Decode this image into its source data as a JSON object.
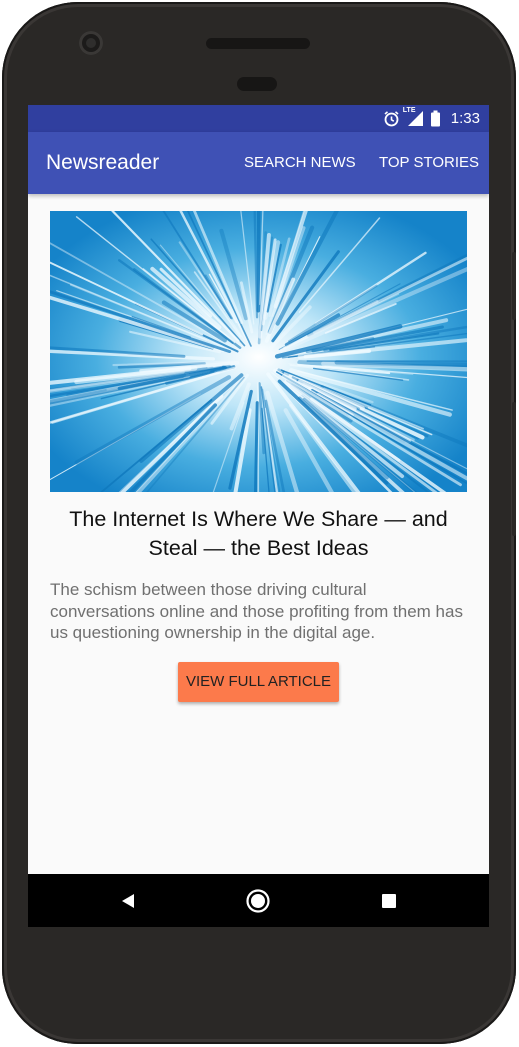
{
  "status_bar": {
    "time": "1:33",
    "network_label": "LTE",
    "icons": [
      "alarm-icon",
      "signal-icon",
      "battery-icon"
    ]
  },
  "app_bar": {
    "title": "Newsreader",
    "actions": [
      {
        "label": "SEARCH NEWS"
      },
      {
        "label": "TOP STORIES"
      }
    ]
  },
  "article": {
    "image_icon": "digital-tunnel-image",
    "headline": "The Internet Is Where We Share — and Steal — the Best Ideas",
    "summary": "The schism between those driving cultural conversations online and those profiting from them has us questioning ownership in the digital age.",
    "button_label": "VIEW FULL ARTICLE"
  },
  "nav_bar": {
    "icons": [
      "back-icon",
      "home-icon",
      "recents-icon"
    ]
  },
  "colors": {
    "status_bar": "#303f9f",
    "app_bar": "#3f51b5",
    "accent_button": "#fc7a4b",
    "screen_bg": "#fafafa"
  }
}
